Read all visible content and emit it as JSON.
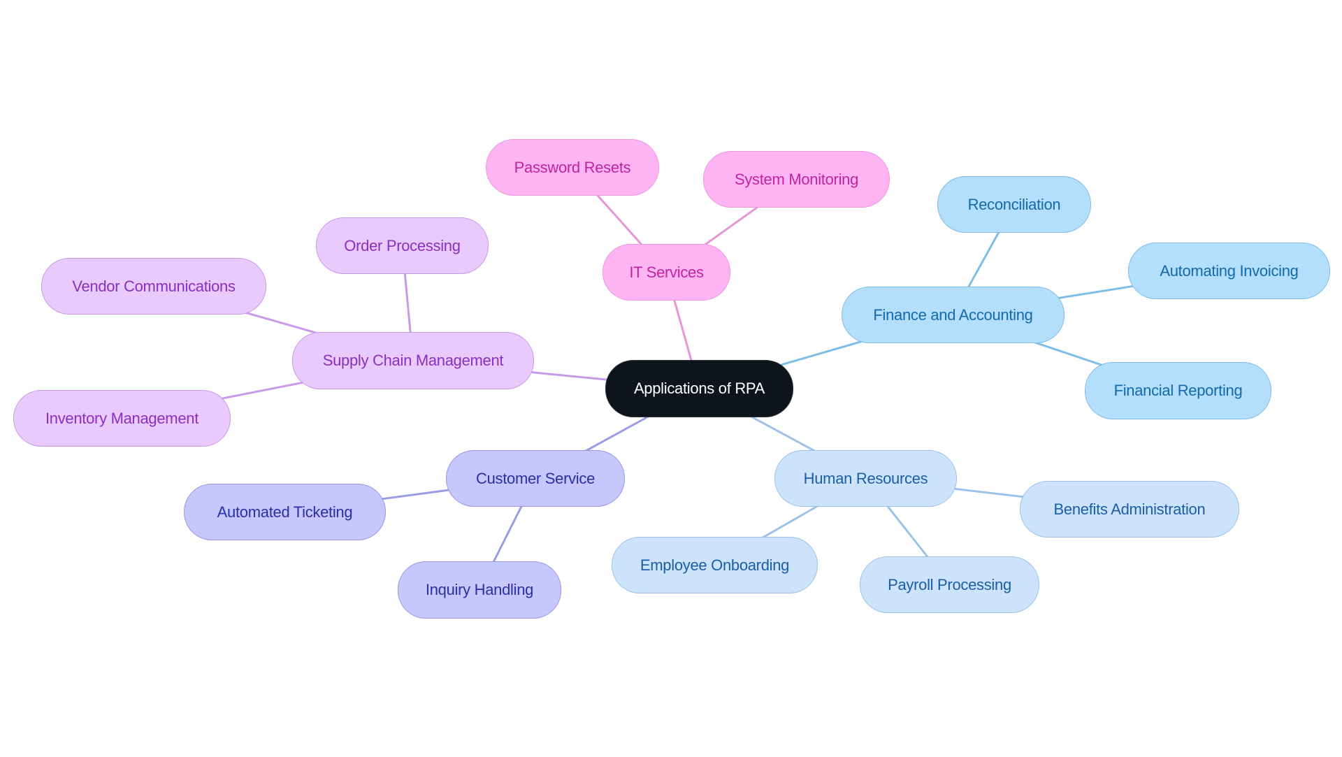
{
  "title": "Applications of RPA",
  "colors": {
    "root_fill": "#0d141c",
    "it_services": "#fdb4f3",
    "finance": "#b3defc",
    "human_resources": "#cde3fb",
    "customer_service": "#c6c8fd",
    "supply_chain": "#e8cafd",
    "edge_it": "#e895d8",
    "edge_finance": "#7fbde6",
    "edge_hr": "#9dc2ea",
    "edge_cs": "#9a9de6",
    "edge_scm": "#c99ae8"
  },
  "mindmap": {
    "root": {
      "id": "root",
      "label": "Applications of RPA"
    },
    "branches": [
      {
        "id": "it",
        "label": "IT Services",
        "children": [
          {
            "id": "it-1",
            "label": "Password Resets"
          },
          {
            "id": "it-2",
            "label": "System Monitoring"
          }
        ]
      },
      {
        "id": "fin",
        "label": "Finance and Accounting",
        "children": [
          {
            "id": "fin-1",
            "label": "Reconciliation"
          },
          {
            "id": "fin-2",
            "label": "Automating Invoicing"
          },
          {
            "id": "fin-3",
            "label": "Financial Reporting"
          }
        ]
      },
      {
        "id": "hr",
        "label": "Human Resources",
        "children": [
          {
            "id": "hr-1",
            "label": "Benefits Administration"
          },
          {
            "id": "hr-2",
            "label": "Employee Onboarding"
          },
          {
            "id": "hr-3",
            "label": "Payroll Processing"
          }
        ]
      },
      {
        "id": "cs",
        "label": "Customer Service",
        "children": [
          {
            "id": "cs-1",
            "label": "Automated Ticketing"
          },
          {
            "id": "cs-2",
            "label": "Inquiry Handling"
          }
        ]
      },
      {
        "id": "scm",
        "label": "Supply Chain Management",
        "children": [
          {
            "id": "scm-1",
            "label": "Order Processing"
          },
          {
            "id": "scm-2",
            "label": "Vendor Communications"
          },
          {
            "id": "scm-3",
            "label": "Inventory Management"
          }
        ]
      }
    ]
  }
}
